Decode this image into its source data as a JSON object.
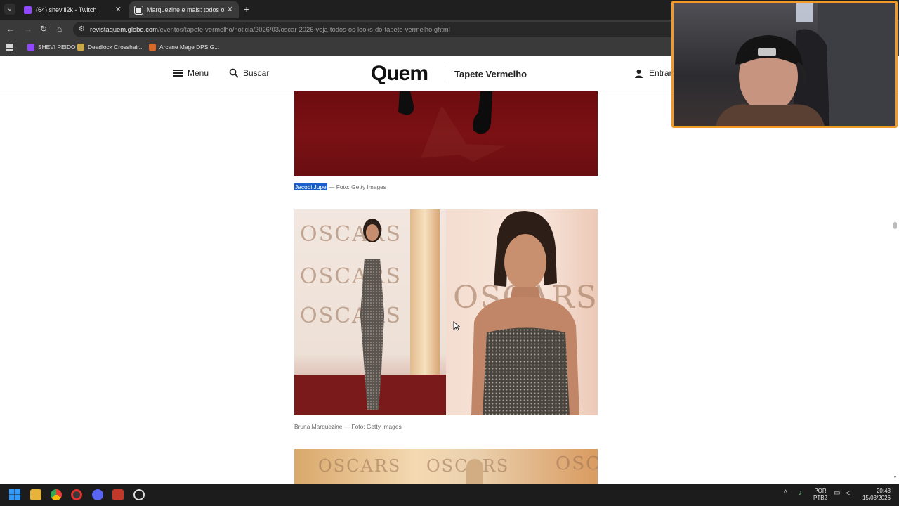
{
  "browser": {
    "tabs": [
      {
        "title": "(64) sheviii2k - Twitch",
        "active": false,
        "favicon_color": "#9146ff"
      },
      {
        "title": "Marquezine e mais: todos os lo",
        "active": true,
        "favicon_color": "#e8e8e8"
      }
    ],
    "url_host": "revistaquem.globo.com",
    "url_path": "/eventos/tapete-vermelho/noticia/2026/03/oscar-2026-veja-todos-os-looks-do-tapete-vermelho.ghtml",
    "bookmarks": [
      {
        "label": "SHEVI PEIDO",
        "color": "#9146ff"
      },
      {
        "label": "Deadlock Crosshair...",
        "color": "#c9a84a"
      },
      {
        "label": "Arcane Mage DPS G...",
        "color": "#d86b2b"
      }
    ]
  },
  "site": {
    "menu_label": "Menu",
    "search_label": "Buscar",
    "logo": "Quem",
    "section": "Tapete Vermelho",
    "login_label": "Entrar"
  },
  "article": {
    "caption1_name": "Jacobi Jupe",
    "caption1_credit": "— Foto: Getty Images",
    "caption2": "Bruna Marquezine — Foto: Getty Images",
    "photo_text": "OSCARS"
  },
  "taskbar": {
    "lang": "POR",
    "layout": "PTB2",
    "time": "20:43",
    "date": "15/03/2026"
  }
}
